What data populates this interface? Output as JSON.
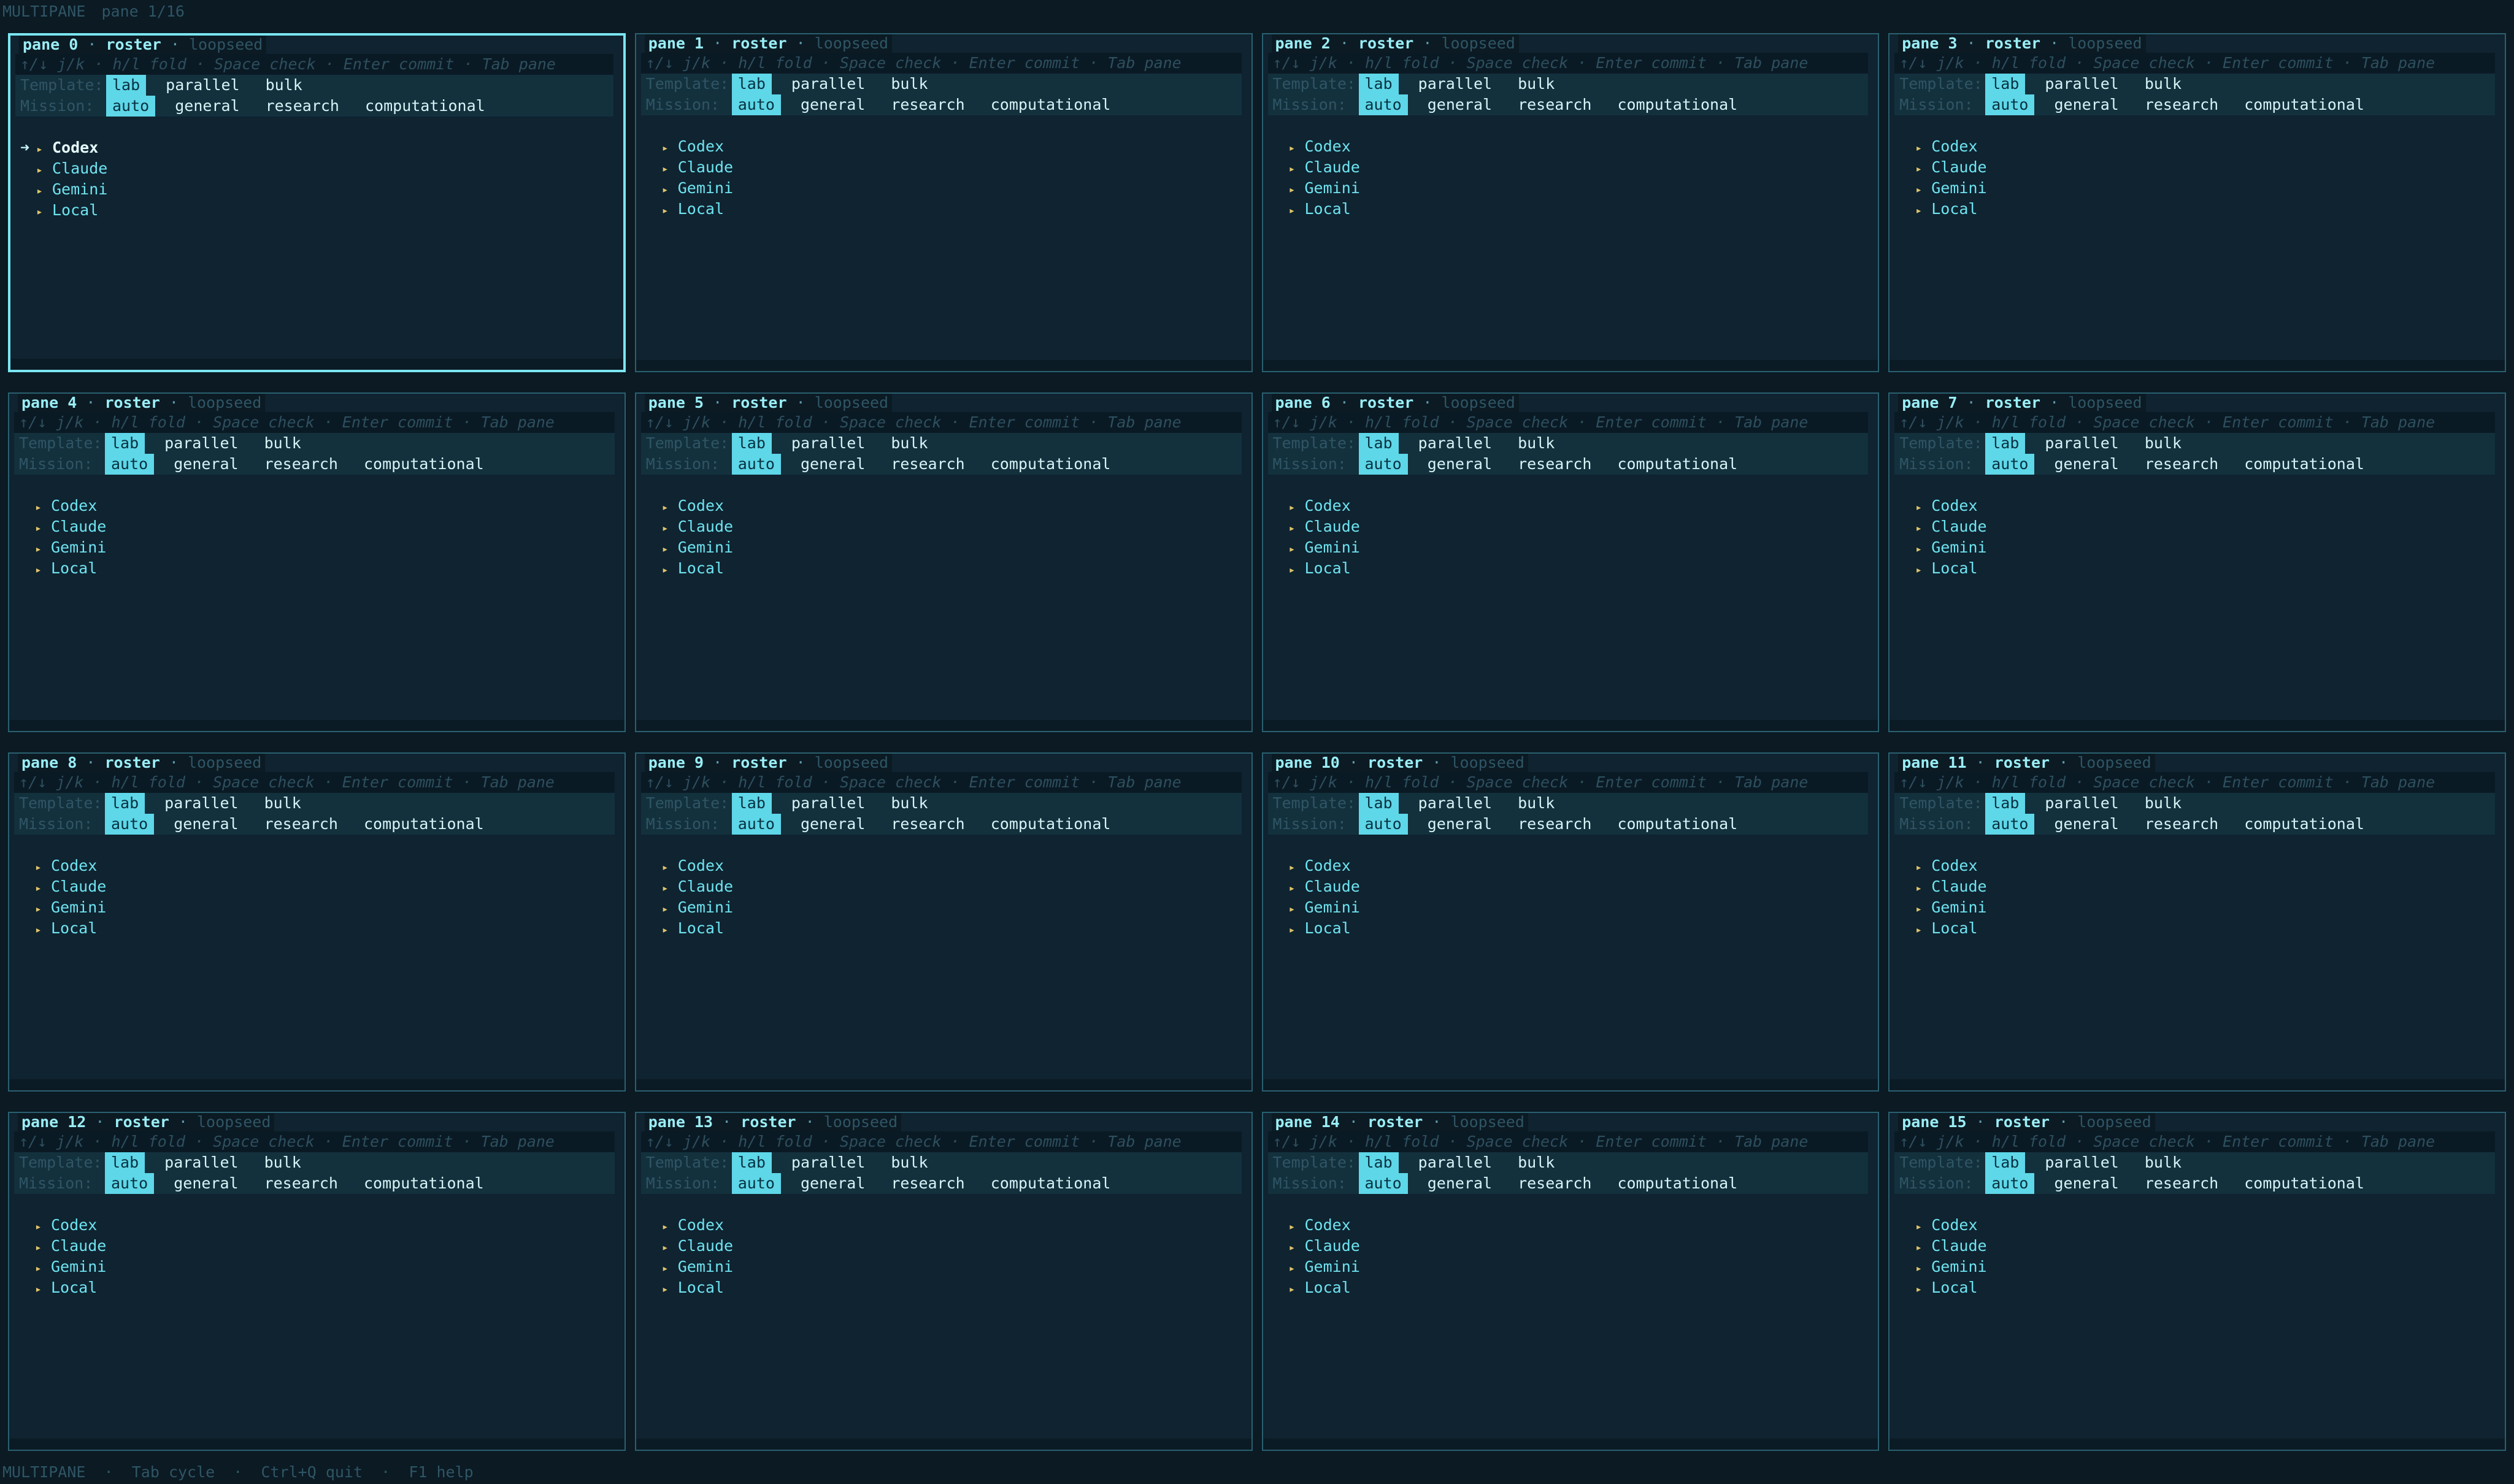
{
  "topbar": {
    "app": "MULTIPANE",
    "pane_counter": "pane 1/16"
  },
  "pane_common": {
    "mode": "roster",
    "seed": "loopseed",
    "hint": "↑/↓ j/k · h/l fold · Space check · Enter commit · Tab pane",
    "template_label": "Template:",
    "mission_label": "Mission:",
    "templates": [
      "lab",
      "parallel",
      "bulk"
    ],
    "missions": [
      "auto",
      "general",
      "research",
      "computational"
    ],
    "selected_template": "lab",
    "selected_mission": "auto",
    "agents": [
      "Codex",
      "Claude",
      "Gemini",
      "Local"
    ]
  },
  "panes": [
    {
      "title": "pane 0",
      "focused": true,
      "cursor_row": 0
    },
    {
      "title": "pane 1"
    },
    {
      "title": "pane 2"
    },
    {
      "title": "pane 3"
    },
    {
      "title": "pane 4"
    },
    {
      "title": "pane 5"
    },
    {
      "title": "pane 6"
    },
    {
      "title": "pane 7"
    },
    {
      "title": "pane 8"
    },
    {
      "title": "pane 9"
    },
    {
      "title": "pane 10"
    },
    {
      "title": "pane 11"
    },
    {
      "title": "pane 12"
    },
    {
      "title": "pane 13"
    },
    {
      "title": "pane 14"
    },
    {
      "title": "pane 15"
    }
  ],
  "statusbar": {
    "items": [
      "MULTIPANE",
      "Tab cycle",
      "Ctrl+Q quit",
      "F1 help"
    ],
    "separator": "·"
  },
  "colors": {
    "background": "#0b1a23",
    "pane_bg": "#0f2330",
    "accent": "#5ed7e8",
    "focused_border": "#7ae6f2",
    "agent_marker": "#e1c56a"
  }
}
